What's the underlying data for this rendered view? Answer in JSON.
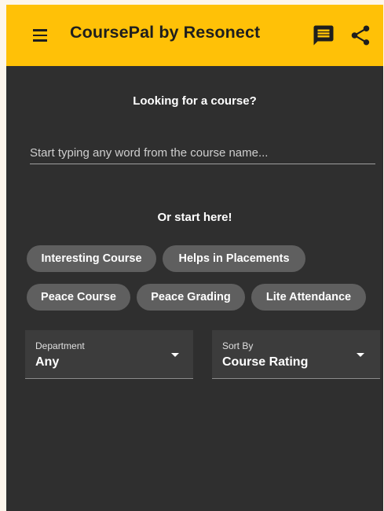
{
  "app_bar": {
    "title": "CoursePal by Resonect",
    "background_color": "#ffc107",
    "icons": [
      "menu-icon",
      "message-icon",
      "share-icon"
    ]
  },
  "search": {
    "heading": "Looking for a course?",
    "placeholder": "Start typing any word from the course name...",
    "value": ""
  },
  "quick_start": {
    "heading": "Or start here!",
    "chips": [
      "Interesting Course",
      "Helps in Placements",
      "Peace Course",
      "Peace Grading",
      "Lite Attendance"
    ]
  },
  "filters": {
    "department": {
      "label": "Department",
      "value": "Any"
    },
    "sort_by": {
      "label": "Sort By",
      "value": "Course Rating"
    }
  }
}
